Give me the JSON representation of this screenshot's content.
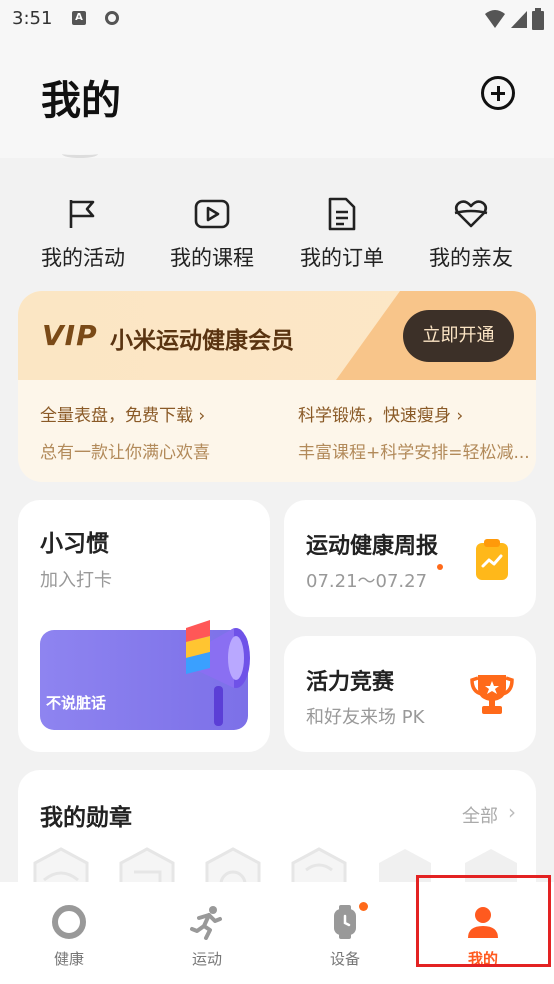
{
  "status_bar": {
    "time": "3:51",
    "a_badge": "A"
  },
  "header": {
    "title": "我的"
  },
  "quick_links": [
    {
      "label": "我的活动",
      "icon": "flag-icon"
    },
    {
      "label": "我的课程",
      "icon": "play-icon"
    },
    {
      "label": "我的订单",
      "icon": "document-icon"
    },
    {
      "label": "我的亲友",
      "icon": "heart-link-icon"
    }
  ],
  "vip": {
    "logo": "VIP",
    "name": "小米运动健康会员",
    "button": "立即开通",
    "features": [
      {
        "title": "全量表盘，免费下载",
        "desc": "总有一款让你满心欢喜"
      },
      {
        "title": "科学锻炼，快速瘦身",
        "desc": "丰富课程+科学安排=轻松减..."
      }
    ]
  },
  "habit": {
    "title": "小习惯",
    "subtitle": "加入打卡",
    "banner_text": "不说脏话"
  },
  "weekly": {
    "title": "运动健康周报",
    "subtitle": "07.21～07.27"
  },
  "compete": {
    "title": "活力竞赛",
    "subtitle": "和好友来场 PK"
  },
  "medals": {
    "title": "我的勋章",
    "all_label": "全部"
  },
  "tabs": [
    {
      "label": "健康",
      "icon": "health-icon"
    },
    {
      "label": "运动",
      "icon": "running-icon"
    },
    {
      "label": "设备",
      "icon": "watch-icon"
    },
    {
      "label": "我的",
      "icon": "person-icon"
    }
  ],
  "colors": {
    "accent": "#ff5a1f",
    "vip_dark": "#3c3028",
    "banner": "#8e84f0",
    "highlight_box": "#e32222"
  }
}
